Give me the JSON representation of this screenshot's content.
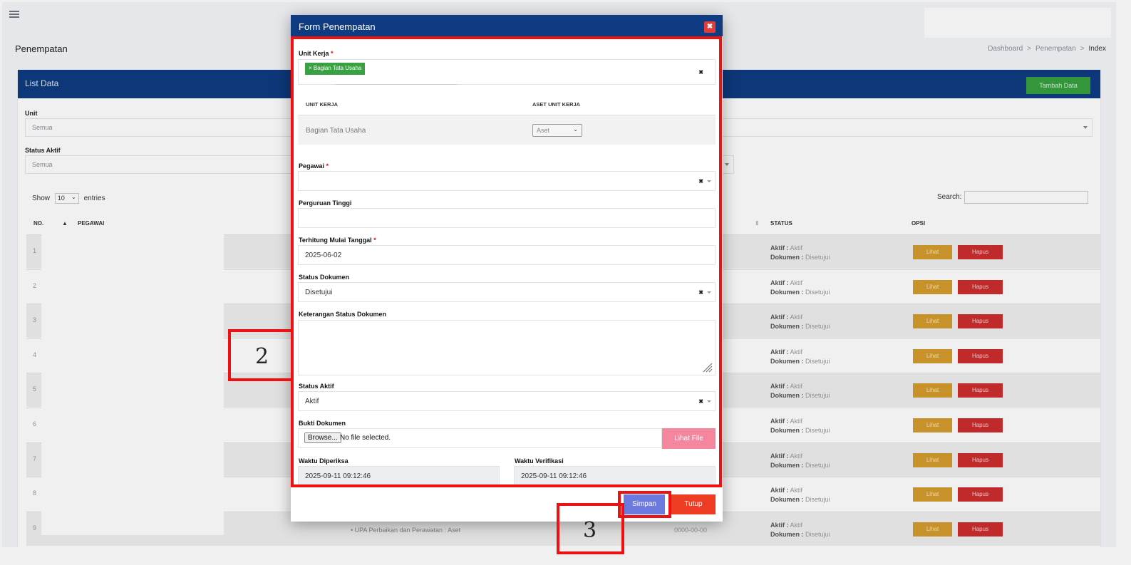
{
  "page": {
    "title": "Penempatan",
    "breadcrumb": [
      "Dashboard",
      "Penempatan",
      "Index"
    ]
  },
  "card": {
    "header": "List Data",
    "add_button": "Tambah Data",
    "filters": {
      "unit_label": "Unit",
      "unit_value": "Semua",
      "status_label": "Status Aktif",
      "status_value": "Semua"
    },
    "show_prefix": "Show",
    "show_value": "10",
    "show_suffix": "entries",
    "search_label": "Search:",
    "columns": [
      "NO.",
      "PEGAWAI",
      "STATUS",
      "OPSI"
    ],
    "rows": [
      {
        "no": "1",
        "aktif": "Aktif",
        "dokumen": "Disetujui"
      },
      {
        "no": "2",
        "aktif": "Aktif",
        "dokumen": "Disetujui"
      },
      {
        "no": "3",
        "aktif": "Aktif",
        "dokumen": "Disetujui"
      },
      {
        "no": "4",
        "aktif": "Aktif",
        "dokumen": "Disetujui"
      },
      {
        "no": "5",
        "aktif": "Aktif",
        "dokumen": "Disetujui"
      },
      {
        "no": "6",
        "aktif": "Aktif",
        "dokumen": "Disetujui"
      },
      {
        "no": "7",
        "aktif": "Aktif",
        "dokumen": "Disetujui"
      },
      {
        "no": "8",
        "aktif": "Aktif",
        "dokumen": "Disetujui"
      },
      {
        "no": "9",
        "aktif": "Aktif",
        "dokumen": "Disetujui",
        "mid": "• UPA Perbaikan dan Perawatan : Aset",
        "date": "0000-00-00"
      }
    ],
    "status_aktif_prefix": "Aktif :",
    "status_dokumen_prefix": "Dokumen :",
    "btn_lihat": "Lihat",
    "btn_hapus": "Hapus"
  },
  "modal": {
    "title": "Form Penempatan",
    "close_icon": "✖",
    "unit_kerja_label": "Unit Kerja",
    "required_mark": "*",
    "unit_kerja_tag": "Bagian Tata Usaha",
    "inner_table": {
      "col1": "UNIT KERJA",
      "col2": "ASET UNIT KERJA",
      "row_unit": "Bagian Tata Usaha",
      "row_aset": "Aset"
    },
    "pegawai_label": "Pegawai",
    "perguruan_label": "Perguruan Tinggi",
    "terhitung_label": "Terhitung Mulai Tanggal",
    "terhitung_value": "2025-06-02",
    "status_dokumen_label": "Status Dokumen",
    "status_dokumen_value": "Disetujui",
    "keterangan_label": "Keterangan Status Dokumen",
    "status_aktif_label": "Status Aktif",
    "status_aktif_value": "Aktif",
    "bukti_label": "Bukti Dokumen",
    "browse_label": "Browse...",
    "no_file": "No file selected.",
    "lihat_file": "Lihat File",
    "waktu_diperiksa_label": "Waktu Diperiksa",
    "waktu_diperiksa_value": "2025-09-11 09:12:46",
    "waktu_verifikasi_label": "Waktu Verifikasi",
    "waktu_verifikasi_value": "2025-09-11 09:12:46",
    "simpan": "Simpan",
    "tutup": "Tutup"
  },
  "annotations": {
    "two": "2",
    "three": "3"
  },
  "colors": {
    "header_blue": "#0e3b81",
    "annotation_red": "#ee1111",
    "green": "#37a03f"
  }
}
